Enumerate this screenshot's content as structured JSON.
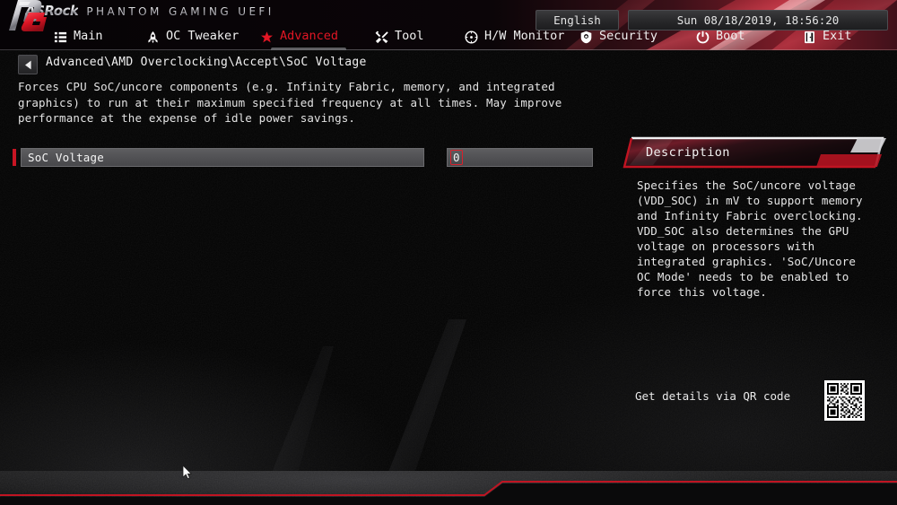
{
  "brand": {
    "asrock": "ASRock",
    "product_line": "PHANTOM  GAMING  UEFI",
    "footer_logo": "phantom-gaming-logo"
  },
  "nav": {
    "items": [
      {
        "label": "Main",
        "icon": "list-icon",
        "active": false
      },
      {
        "label": "OC Tweaker",
        "icon": "rocket-icon",
        "active": false
      },
      {
        "label": "Advanced",
        "icon": "star-icon",
        "active": true
      },
      {
        "label": "Tool",
        "icon": "tools-icon",
        "active": false
      },
      {
        "label": "H/W Monitor",
        "icon": "gauge-icon",
        "active": false
      },
      {
        "label": "Security",
        "icon": "shield-icon",
        "active": false
      },
      {
        "label": "Boot",
        "icon": "power-icon",
        "active": false
      },
      {
        "label": "Exit",
        "icon": "exit-door-icon",
        "active": false
      }
    ],
    "active_color": "#e11624"
  },
  "breadcrumb": {
    "back_icon": "back-arrow-icon",
    "path": "Advanced\\AMD Overclocking\\Accept\\SoC Voltage"
  },
  "help_text": "Forces CPU SoC/uncore components (e.g. Infinity Fabric, memory, and integrated graphics) to run at their maximum specified frequency at all times. May improve performance at the expense of idle power savings.",
  "option": {
    "label": "SoC Voltage",
    "value": "0"
  },
  "description": {
    "title": "Description",
    "text": "Specifies the SoC/uncore voltage (VDD_SOC) in mV to support memory and Infinity Fabric overclocking. VDD_SOC also determines the GPU voltage on processors with integrated graphics. 'SoC/Uncore OC Mode' needs to be enabled to force this voltage."
  },
  "qr": {
    "label": "Get details via QR code",
    "icon": "qr-code-icon"
  },
  "footer": {
    "language": "English",
    "datetime": "Sun 08/18/2019, 18:56:20"
  },
  "colors": {
    "accent_red": "#c81523",
    "panel_grey": "#525255",
    "text": "#e8e8e8"
  }
}
